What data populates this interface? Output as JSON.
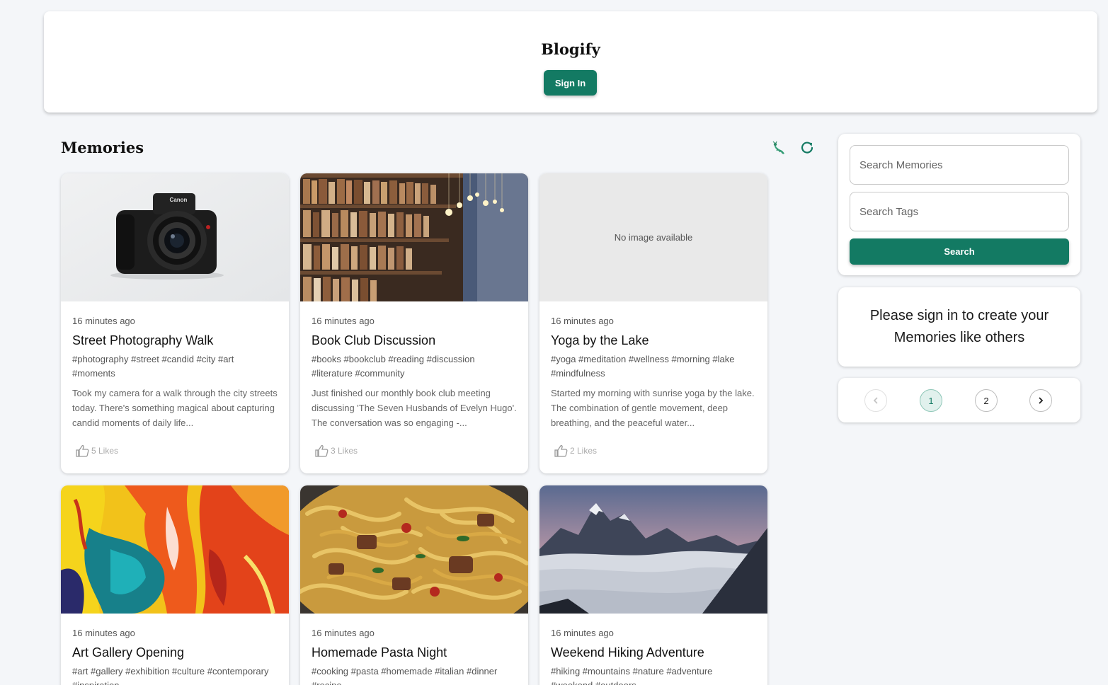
{
  "app": {
    "title": "Blogify",
    "sign_in_label": "Sign In"
  },
  "section": {
    "title": "Memories"
  },
  "posts": [
    {
      "time": "16 minutes ago",
      "title": "Street Photography Walk",
      "tags": "#photography #street #candid #city #art #moments",
      "message": "Took my camera for a walk through the city streets today. There's something magical about capturing candid moments of daily life...",
      "likes": "5 Likes",
      "image": "camera"
    },
    {
      "time": "16 minutes ago",
      "title": "Book Club Discussion",
      "tags": "#books #bookclub #reading #discussion #literature #community",
      "message": "Just finished our monthly book club meeting discussing 'The Seven Husbands of Evelyn Hugo'. The conversation was so engaging -...",
      "likes": "3 Likes",
      "image": "library"
    },
    {
      "time": "16 minutes ago",
      "title": "Yoga by the Lake",
      "tags": "#yoga #meditation #wellness #morning #lake #mindfulness",
      "message": "Started my morning with sunrise yoga by the lake. The combination of gentle movement, deep breathing, and the peaceful water...",
      "likes": "2 Likes",
      "image": "none",
      "no_image_text": "No image available"
    },
    {
      "time": "16 minutes ago",
      "title": "Art Gallery Opening",
      "tags": "#art #gallery #exhibition #culture #contemporary #inspiration",
      "message": "",
      "likes": "",
      "image": "painting"
    },
    {
      "time": "16 minutes ago",
      "title": "Homemade Pasta Night",
      "tags": "#cooking #pasta #homemade #italian #dinner #recipe",
      "message": "",
      "likes": "",
      "image": "pasta"
    },
    {
      "time": "16 minutes ago",
      "title": "Weekend Hiking Adventure",
      "tags": "#hiking #mountains #nature #adventure #weekend #outdoors",
      "message": "",
      "likes": "",
      "image": "mountains"
    }
  ],
  "search": {
    "memories_placeholder": "Search Memories",
    "tags_placeholder": "Search Tags",
    "button_label": "Search"
  },
  "signin_prompt": "Please sign in to create your Memories like others",
  "pagination": {
    "pages": [
      "1",
      "2"
    ],
    "current": "1"
  },
  "colors": {
    "accent": "#137a63",
    "background": "#f4f6f9"
  }
}
